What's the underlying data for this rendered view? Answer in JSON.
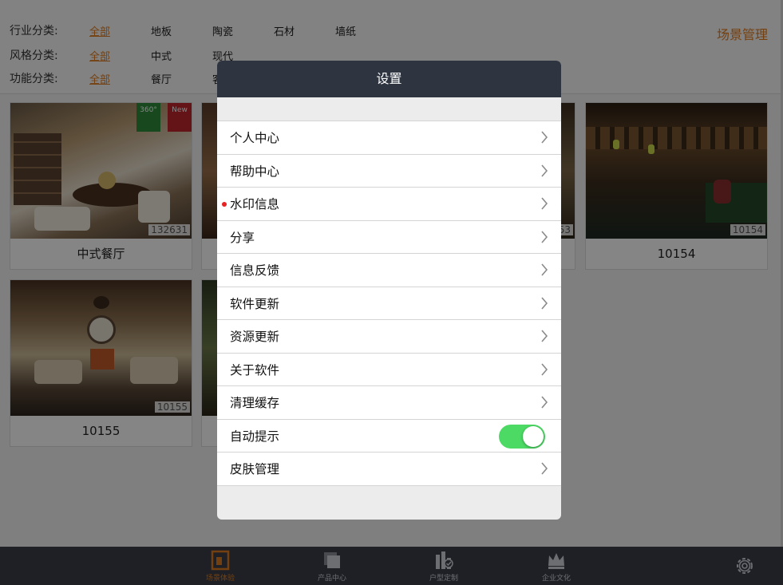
{
  "filters": {
    "rows": [
      {
        "label": "行业分类:",
        "options": [
          "全部",
          "地板",
          "陶瓷",
          "石材",
          "墙纸"
        ]
      },
      {
        "label": "风格分类:",
        "options": [
          "全部",
          "中式",
          "现代"
        ]
      },
      {
        "label": "功能分类:",
        "options": [
          "全部",
          "餐厅",
          "客"
        ]
      }
    ],
    "scene_management": "场景管理"
  },
  "cards": [
    {
      "caption": "中式餐厅",
      "id_tag": "132631",
      "badges": [
        "360°",
        "New"
      ]
    },
    {
      "caption": "10154",
      "id_tag": "10154"
    },
    {
      "caption": "10155",
      "id_tag": "10155"
    }
  ],
  "hidden_card_tag": "53",
  "modal": {
    "title": "设置",
    "items": [
      {
        "label": "个人中心"
      },
      {
        "label": "帮助中心"
      },
      {
        "label": "水印信息"
      },
      {
        "label": "分享"
      },
      {
        "label": "信息反馈"
      },
      {
        "label": "软件更新"
      },
      {
        "label": "资源更新"
      },
      {
        "label": "关于软件"
      },
      {
        "label": "清理缓存"
      },
      {
        "label": "自动提示",
        "toggle": true
      },
      {
        "label": "皮肤管理"
      }
    ]
  },
  "tabbar": {
    "tabs": [
      {
        "label": "场景体验",
        "icon": "scene-icon",
        "active": true
      },
      {
        "label": "产品中心",
        "icon": "product-icon"
      },
      {
        "label": "户型定制",
        "icon": "floorplan-icon"
      },
      {
        "label": "企业文化",
        "icon": "crown-icon"
      }
    ],
    "settings_icon": "gear-icon"
  },
  "colors": {
    "accent": "#e07b1d",
    "header": "#2e3541",
    "toggle_on": "#4cd964",
    "tabbar": "#3a3f4a"
  }
}
